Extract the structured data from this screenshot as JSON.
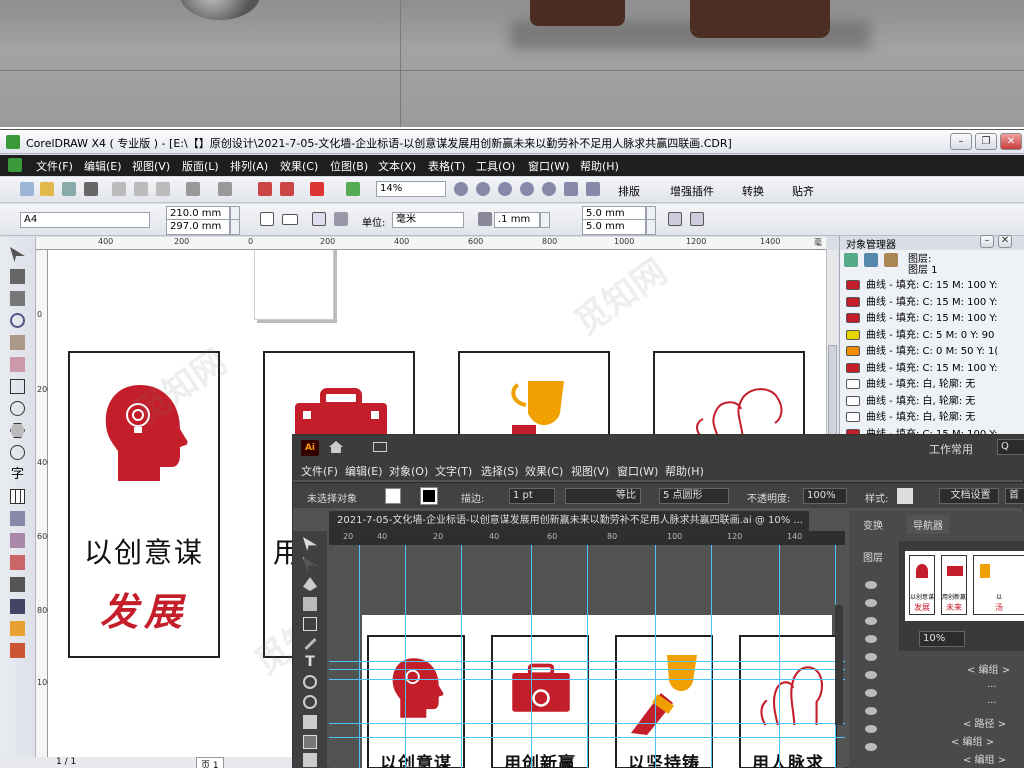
{
  "corel": {
    "title": "CorelDRAW X4 ( 专业版 ) - [E:\\【】原创设计\\2021-7-05-文化墙-企业标语-以创意谋发展用创新赢未来以勤劳补不足用人脉求共赢四联画.CDR]",
    "menu": [
      "文件(F)",
      "编辑(E)",
      "视图(V)",
      "版面(L)",
      "排列(A)",
      "效果(C)",
      "位图(B)",
      "文本(X)",
      "表格(T)",
      "工具(O)",
      "窗口(W)",
      "帮助(H)"
    ],
    "toolbar": {
      "zoom": "14%",
      "plugin_buttons": [
        "排版",
        "增强插件",
        "转换",
        "贴齐"
      ]
    },
    "props": {
      "paper": "A4",
      "width": "210.0 mm",
      "height": "297.0 mm",
      "unit_label": "单位:",
      "unit": "毫米",
      "nudge": ".1 mm",
      "dup_x": "5.0 mm",
      "dup_y": "5.0 mm"
    },
    "ruler_h": [
      "400",
      "200",
      "0",
      "200",
      "400",
      "600",
      "800",
      "1000",
      "1200",
      "1400",
      "毫米"
    ],
    "ruler_v": [
      "0",
      "200",
      "400",
      "600",
      "800",
      "1000"
    ],
    "panels": [
      {
        "line1": "以创意谋",
        "line2": "发展"
      },
      {
        "line1": "用",
        "line2": ""
      }
    ],
    "object_manager": {
      "title": "对象管理器",
      "layer_label": "图层:",
      "layer_name": "图层 1",
      "rows": [
        {
          "text": "曲线 - 填充: C: 15 M: 100 Y:",
          "color": "#c41e2a"
        },
        {
          "text": "曲线 - 填充: C: 15 M: 100 Y:",
          "color": "#c41e2a"
        },
        {
          "text": "曲线 - 填充: C: 15 M: 100 Y:",
          "color": "#c41e2a"
        },
        {
          "text": "曲线 - 填充: C: 5 M: 0 Y: 90",
          "color": "#e8d400"
        },
        {
          "text": "曲线 - 填充: C: 0 M: 50 Y: 1(",
          "color": "#f08c00"
        },
        {
          "text": "曲线 - 填充: C: 15 M: 100 Y:",
          "color": "#c41e2a"
        },
        {
          "text": "曲线 - 填充: 白, 轮廓: 无",
          "color": "#ffffff"
        },
        {
          "text": "曲线 - 填充: 白, 轮廓: 无",
          "color": "#ffffff"
        },
        {
          "text": "曲线 - 填充: 白, 轮廓: 无",
          "color": "#ffffff"
        },
        {
          "text": "曲线 - 填充: C: 15 M: 100 Y:",
          "color": "#c41e2a"
        }
      ]
    },
    "status": {
      "pages": "1 / 1",
      "page_tab": "页 1"
    }
  },
  "ai": {
    "logo": "Ai",
    "workspace": "工作常用",
    "menu": [
      "文件(F)",
      "编辑(E)",
      "对象(O)",
      "文字(T)",
      "选择(S)",
      "效果(C)",
      "视图(V)",
      "窗口(W)",
      "帮助(H)"
    ],
    "control": {
      "no_selection": "未选择对象",
      "stroke_label": "描边:",
      "stroke_value": "1 pt",
      "stroke_style": "等比",
      "brush": "5 点圆形",
      "opacity_label": "不透明度:",
      "opacity_value": "100%",
      "style_label": "样式:",
      "doc_settings": "文档设置",
      "prefs": "首"
    },
    "doc_tab": "2021-7-05-文化墙-企业标语-以创意谋发展用创新赢未来以勤劳补不足用人脉求共赢四联画.ai @ 10% ...",
    "ruler": [
      "20",
      "40",
      "20",
      "40",
      "60",
      "80",
      "100",
      "120",
      "140"
    ],
    "panels": [
      "以创意谋",
      "用创新赢",
      "以坚持铸",
      "用人脉求"
    ],
    "right_tabs": [
      "变换",
      "导航器",
      "图层"
    ],
    "navigator": {
      "zoom": "10%",
      "thumbs": [
        {
          "t1": "以创意谋",
          "t2": "发展"
        },
        {
          "t1": "用创新赢",
          "t2": "未来"
        },
        {
          "t1": "以",
          "t2": "汤"
        }
      ]
    },
    "layers": [
      "< 编组 >",
      "...",
      "...",
      "< 路径 >",
      "< 编组 >",
      "< 编组 >",
      "< 编组 >"
    ]
  },
  "colors": {
    "brand_red": "#c41e2a",
    "trophy_orange": "#f0a000",
    "corel_menu_bg": "#1e1e1e",
    "ai_bg": "#535353"
  }
}
